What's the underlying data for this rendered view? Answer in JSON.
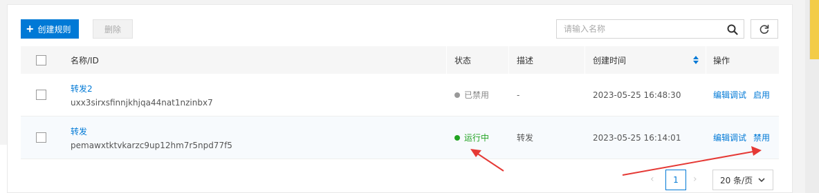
{
  "toolbar": {
    "create_label": "创建规则",
    "delete_label": "删除",
    "search_placeholder": "请输入名称"
  },
  "table": {
    "columns": {
      "name": "名称/ID",
      "status": "状态",
      "desc": "描述",
      "created": "创建时间",
      "ops": "操作"
    },
    "rows": [
      {
        "name": "转发2",
        "id": "uxx3sirxsfinnjkhjqa44nat1nzinbx7",
        "status": "已禁用",
        "status_color": "#999999",
        "desc": "-",
        "created": "2023-05-25 16:48:30",
        "op1": "编辑调试",
        "op2": "启用"
      },
      {
        "name": "转发",
        "id": "pemawxtktvkarzc9up12hm7r5npd77f5",
        "status": "运行中",
        "status_color": "#22a322",
        "desc": "转发",
        "created": "2023-05-25 16:14:01",
        "op1": "编辑调试",
        "op2": "禁用"
      }
    ]
  },
  "pagination": {
    "current_page": "1",
    "page_size": "20 条/页"
  },
  "colors": {
    "accent": "#0079d6",
    "annotation_arrow": "#e53935"
  }
}
